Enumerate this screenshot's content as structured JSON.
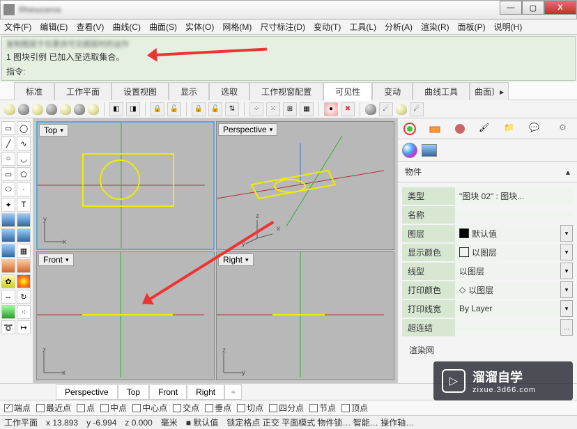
{
  "title": "Rhinoceros",
  "window": {
    "min": "—",
    "max": "▢",
    "close": "X"
  },
  "menu": [
    "文件(F)",
    "编辑(E)",
    "查看(V)",
    "曲线(C)",
    "曲面(S)",
    "实体(O)",
    "网格(M)",
    "尺寸标注(D)",
    "变动(T)",
    "工具(L)",
    "分析(A)",
    "渲染(R)",
    "面板(P)",
    "说明(H)"
  ],
  "msg_blur": "复制图层于仅更改可见图层时的运作",
  "msg_line": "1 图块引例 已加入至选取集合。",
  "cmd_label": "指令:",
  "tabs": [
    "标准",
    "工作平面",
    "设置视图",
    "显示",
    "选取",
    "工作视窗配置",
    "可见性",
    "变动",
    "曲线工具",
    "曲面"
  ],
  "tabs_active": 6,
  "viewports": {
    "tl": "Top",
    "tr": "Perspective",
    "bl": "Front",
    "br": "Right",
    "axes": {
      "x": "x",
      "y": "y",
      "z": "z"
    }
  },
  "vtabs": [
    "Perspective",
    "Top",
    "Front",
    "Right"
  ],
  "props": {
    "header": "物件",
    "rows": [
      {
        "label": "类型",
        "value": "\"图块 02\" : 图块...",
        "dd": false
      },
      {
        "label": "名称",
        "value": "",
        "dd": false
      },
      {
        "label": "图层",
        "value": "默认值",
        "swatch": "bk",
        "dd": true
      },
      {
        "label": "显示颜色",
        "value": "以图层",
        "swatch": "",
        "dd": true
      },
      {
        "label": "线型",
        "value": "以图层",
        "dd": true
      },
      {
        "label": "打印颜色",
        "value": "以图层",
        "diamond": true,
        "dd": true
      },
      {
        "label": "打印线宽",
        "value": "By Layer",
        "dd": true
      },
      {
        "label": "超连结",
        "value": "...",
        "dd": false
      }
    ],
    "footer": "渲染网"
  },
  "snaps": [
    {
      "t": "端点",
      "c": true
    },
    {
      "t": "最近点",
      "c": false
    },
    {
      "t": "点",
      "c": false
    },
    {
      "t": "中点",
      "c": false
    },
    {
      "t": "中心点",
      "c": false
    },
    {
      "t": "交点",
      "c": false
    },
    {
      "t": "垂点",
      "c": false
    },
    {
      "t": "切点",
      "c": false
    },
    {
      "t": "四分点",
      "c": false
    },
    {
      "t": "节点",
      "c": false
    },
    {
      "t": "顶点",
      "c": false
    }
  ],
  "status": {
    "plane": "工作平面",
    "x": "x 13.893",
    "y": "y -6.994",
    "z": "z 0.000",
    "unit": "毫米",
    "layer": "默认值",
    "extras": "锁定格点 正交 平面模式 物件锁… 智能… 操作轴…"
  },
  "watermark": {
    "brand": "溜溜自学",
    "url": "zixue.3d66.com",
    "icon": "▷"
  }
}
